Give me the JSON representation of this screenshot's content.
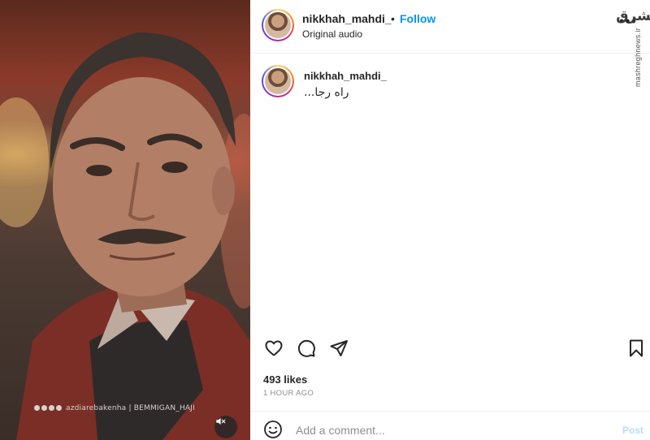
{
  "post": {
    "media": {
      "watermark": "azdiarebakenha | BEMMIGAN_HAJI",
      "mute_icon": "speaker-muted-icon"
    },
    "header": {
      "username": "nikkhah_mahdi_",
      "separator": "•",
      "follow_label": "Follow",
      "audio_label": "Original audio",
      "more_label": "•••"
    },
    "caption": {
      "username": "nikkhah_mahdi_",
      "text": "راه رجا..."
    },
    "actions": {
      "like_icon": "heart-icon",
      "comment_icon": "comment-bubble-icon",
      "share_icon": "paper-plane-icon",
      "save_icon": "bookmark-icon"
    },
    "likes_label": "493 likes",
    "timestamp": "1 HOUR AGO",
    "comment_box": {
      "emoji_icon": "emoji-icon",
      "placeholder": "Add a comment...",
      "post_label": "Post"
    }
  },
  "brand": {
    "logo_text": "مشرق",
    "site": "mashreghnews.ir"
  },
  "colors": {
    "follow_blue": "#0095f6",
    "post_disabled": "#b2dffc",
    "muted_text": "#8e8e8e",
    "text": "#262626"
  }
}
